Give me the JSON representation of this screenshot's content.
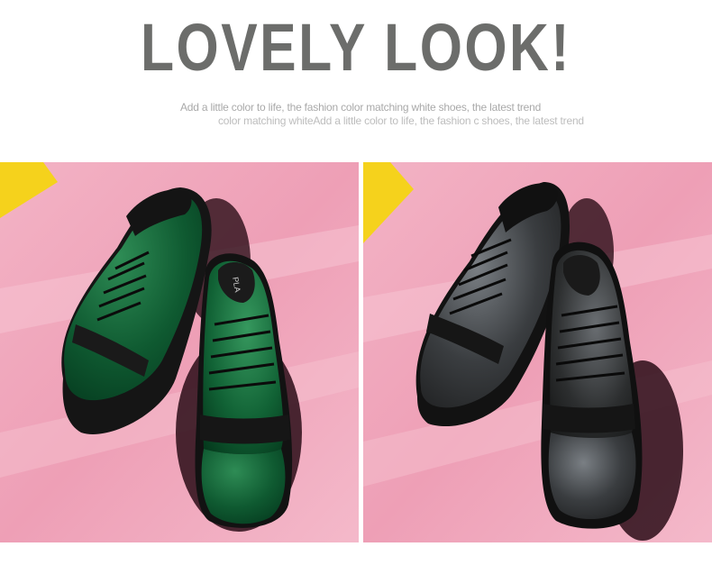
{
  "heading": {
    "title": "LOVELY LOOK!",
    "subtitle_line1": "Add a little color to life, the fashion color matching white shoes, the latest trend",
    "subtitle_line2": "color matching whiteAdd a little color to life, the fashion c shoes, the latest trend"
  },
  "photos": [
    {
      "name": "green-velvet-shoes",
      "shoe_color": "#0f5a31",
      "shoe_highlight": "#2a8a52",
      "background": "#f0a7bd",
      "accent": "#f5d21c"
    },
    {
      "name": "black-velvet-shoes",
      "shoe_color": "#2c2e2f",
      "shoe_highlight": "#6a6e72",
      "background": "#f0a7bd",
      "accent": "#f5d21c"
    }
  ],
  "insole_text": "PLA"
}
